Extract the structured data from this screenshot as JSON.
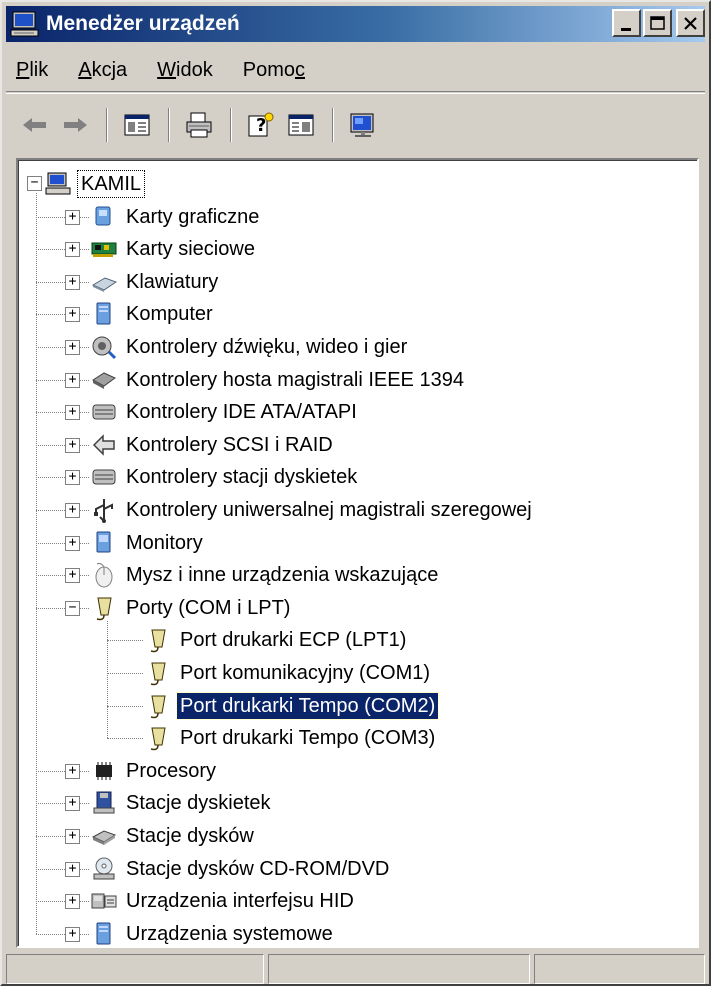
{
  "window": {
    "title": "Menedżer urządzeń",
    "icon": "computer-monitor-icon",
    "controls": [
      "minimize-icon",
      "maximize-icon",
      "close-icon"
    ]
  },
  "menu": {
    "items": [
      {
        "label_pre": "",
        "label_ul": "P",
        "label_post": "lik"
      },
      {
        "label_pre": "",
        "label_ul": "A",
        "label_post": "kcja"
      },
      {
        "label_pre": "",
        "label_ul": "W",
        "label_post": "idok"
      },
      {
        "label_pre": "Pomo",
        "label_ul": "c",
        "label_post": ""
      }
    ]
  },
  "toolbar": {
    "buttons": [
      "back-arrow-icon",
      "forward-arrow-icon",
      "properties-panel-icon",
      "print-icon",
      "help-icon",
      "console-tree-icon",
      "scan-hardware-icon"
    ]
  },
  "tree": {
    "root": "KAMIL",
    "categories": [
      {
        "label": "Karty graficzne",
        "icon": "display-adapter-icon"
      },
      {
        "label": "Karty sieciowe",
        "icon": "network-card-icon"
      },
      {
        "label": "Klawiatury",
        "icon": "keyboard-icon"
      },
      {
        "label": "Komputer",
        "icon": "computer-icon"
      },
      {
        "label": "Kontrolery dźwięku, wideo i gier",
        "icon": "sound-icon"
      },
      {
        "label": "Kontrolery hosta magistrali IEEE 1394",
        "icon": "ieee1394-icon"
      },
      {
        "label": "Kontrolery IDE ATA/ATAPI",
        "icon": "ide-controller-icon"
      },
      {
        "label": "Kontrolery SCSI i RAID",
        "icon": "scsi-icon"
      },
      {
        "label": "Kontrolery stacji dyskietek",
        "icon": "floppy-controller-icon"
      },
      {
        "label": "Kontrolery uniwersalnej magistrali szeregowej",
        "icon": "usb-icon"
      },
      {
        "label": "Monitory",
        "icon": "monitor-icon"
      },
      {
        "label": "Mysz i inne urządzenia wskazujące",
        "icon": "mouse-icon"
      },
      {
        "label": "Porty (COM i LPT)",
        "icon": "port-icon",
        "expanded": true
      },
      {
        "label": "Procesory",
        "icon": "processor-icon"
      },
      {
        "label": "Stacje dyskietek",
        "icon": "floppy-drive-icon"
      },
      {
        "label": "Stacje dysków",
        "icon": "disk-drive-icon"
      },
      {
        "label": "Stacje dysków CD-ROM/DVD",
        "icon": "cdrom-icon"
      },
      {
        "label": "Urządzenia interfejsu HID",
        "icon": "hid-icon"
      },
      {
        "label": "Urządzenia systemowe",
        "icon": "system-devices-icon"
      }
    ],
    "ports": [
      {
        "label": "Port drukarki ECP (LPT1)",
        "selected": false
      },
      {
        "label": "Port komunikacyjny (COM1)",
        "selected": false
      },
      {
        "label": "Port drukarki  Tempo (COM2)",
        "selected": true
      },
      {
        "label": "Port drukarki  Tempo (COM3)",
        "selected": false
      }
    ]
  },
  "statusbar": {
    "panes": [
      "",
      "",
      ""
    ]
  },
  "colors": {
    "face": "#d4d0c8",
    "title_start": "#0a246a",
    "title_end": "#a6caf0",
    "selection": "#0a246a"
  }
}
